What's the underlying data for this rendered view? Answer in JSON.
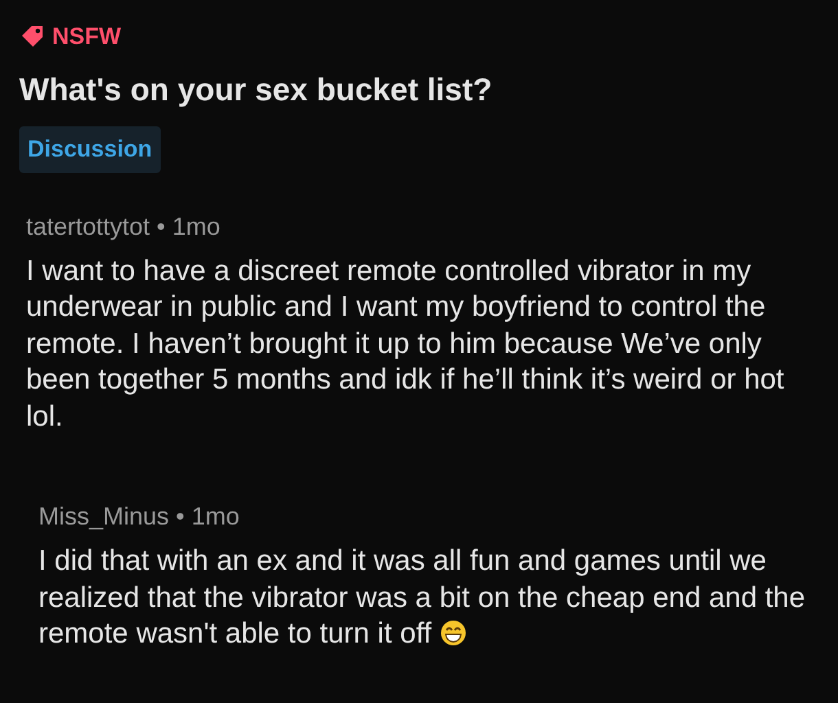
{
  "post": {
    "tag": "NSFW",
    "title": "What's on your sex bucket list?",
    "flair": "Discussion"
  },
  "comments": [
    {
      "author": "tatertottytot",
      "separator": "•",
      "age": "1mo",
      "body": "I want to have a discreet remote controlled vibrator in my underwear in public and I want my boyfriend to control the remote. I haven’t brought it up to him because We’ve only been together 5 months and idk if he’ll think it’s weird or hot lol.",
      "emoji": false
    },
    {
      "author": "Miss_Minus",
      "separator": "•",
      "age": "1mo",
      "body": "I did that with an ex and it was all fun and games until we realized that the vibrator was a bit on the cheap end and the remote wasn't able to turn it off",
      "emoji": true
    }
  ]
}
